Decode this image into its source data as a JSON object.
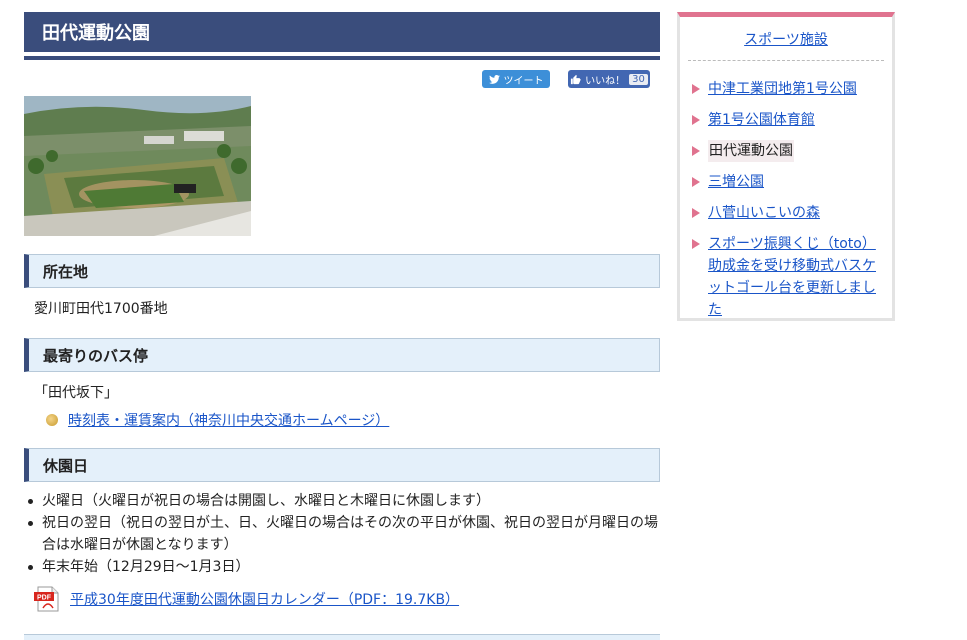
{
  "page_title": "田代運動公園",
  "social": {
    "tweet_label": "ツイート",
    "like_label": "いいね！",
    "like_count": "30"
  },
  "sections": {
    "location": {
      "heading": "所在地",
      "text": "愛川町田代1700番地"
    },
    "bus": {
      "heading": "最寄りのバス停",
      "stop": "「田代坂下」",
      "link": "時刻表・運賃案内（神奈川中央交通ホームページ）"
    },
    "closed": {
      "heading": "休園日",
      "items": [
        "火曜日（火曜日が祝日の場合は開園し、水曜日と木曜日に休園します）",
        "祝日の翌日（祝日の翌日が土、日、火曜日の場合はその次の平日が休園、祝日の翌日が月曜日の場合は水曜日が休園となります）",
        "年末年始（12月29日～1月3日）"
      ],
      "pdf_link": "平成30年度田代運動公園休園日カレンダー（PDF：19.7KB）",
      "pdf_icon_text": "PDF"
    }
  },
  "sidebar": {
    "title": "スポーツ施設",
    "items": [
      {
        "label": "中津工業団地第1号公園",
        "current": false
      },
      {
        "label": "第1号公園体育館",
        "current": false
      },
      {
        "label": "田代運動公園",
        "current": true
      },
      {
        "label": "三増公園",
        "current": false
      },
      {
        "label": "八菅山いこいの森",
        "current": false
      },
      {
        "label": "スポーツ振興くじ（toto）助成金を受け移動式バスケットゴール台を更新しました",
        "current": false
      }
    ]
  },
  "colors": {
    "title_bar": "#3a4d7c",
    "section_bg": "#e4f0fa",
    "sidebar_accent": "#e0738f",
    "link": "#1a55c8"
  }
}
